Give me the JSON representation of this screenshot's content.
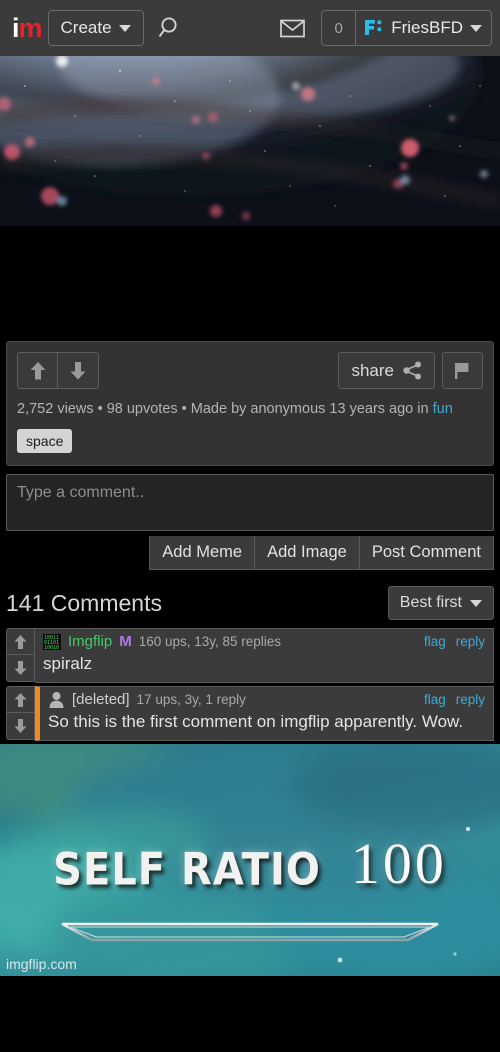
{
  "header": {
    "logo_i": "i",
    "logo_m": "m",
    "create_label": "Create",
    "search_icon": "search-icon",
    "mail_icon": "mail-icon",
    "notification_count": "0",
    "favicon_label": "F:",
    "username": "FriesBFD",
    "accent_cyan": "#29bde8",
    "logo_red": "#e8222c"
  },
  "post": {
    "upvote_icon": "arrow-up-icon",
    "downvote_icon": "arrow-down-icon",
    "share_label": "share",
    "share_icon": "share-nodes-icon",
    "flag_icon": "flag-icon",
    "meta": "2,752 views • 98 upvotes • Made by anonymous 13 years ago in",
    "stream_link": "fun",
    "tag": "space",
    "views": "2,752",
    "upvotes": "98",
    "author": "anonymous",
    "age": "13 years ago"
  },
  "comment_form": {
    "placeholder": "Type a comment..",
    "value": "",
    "add_meme_label": "Add Meme",
    "add_image_label": "Add Image",
    "post_label": "Post Comment"
  },
  "comments_header": {
    "count_label": "141 Comments",
    "count": "141",
    "sort_label": "Best first"
  },
  "comments": [
    {
      "avatar": "imgflip-binary-avatar",
      "author": "Imgflip",
      "badge": "M",
      "stats": "160 ups, 13y, 85 replies",
      "flag": "flag",
      "reply": "reply",
      "text": "spiralz",
      "nested": false,
      "author_color": "#47c96a"
    },
    {
      "avatar": "deleted-user-avatar",
      "author": "[deleted]",
      "badge": "",
      "stats": "17 ups, 3y, 1 reply",
      "flag": "flag",
      "reply": "reply",
      "text": "So this is the first comment on imgflip apparently. Wow.",
      "nested": true,
      "author_color": "#cfcfcf"
    }
  ],
  "meme": {
    "label": "SELF RATIO",
    "number": "100",
    "watermark": "imgflip.com",
    "template": "skyrim-skill-increase"
  }
}
